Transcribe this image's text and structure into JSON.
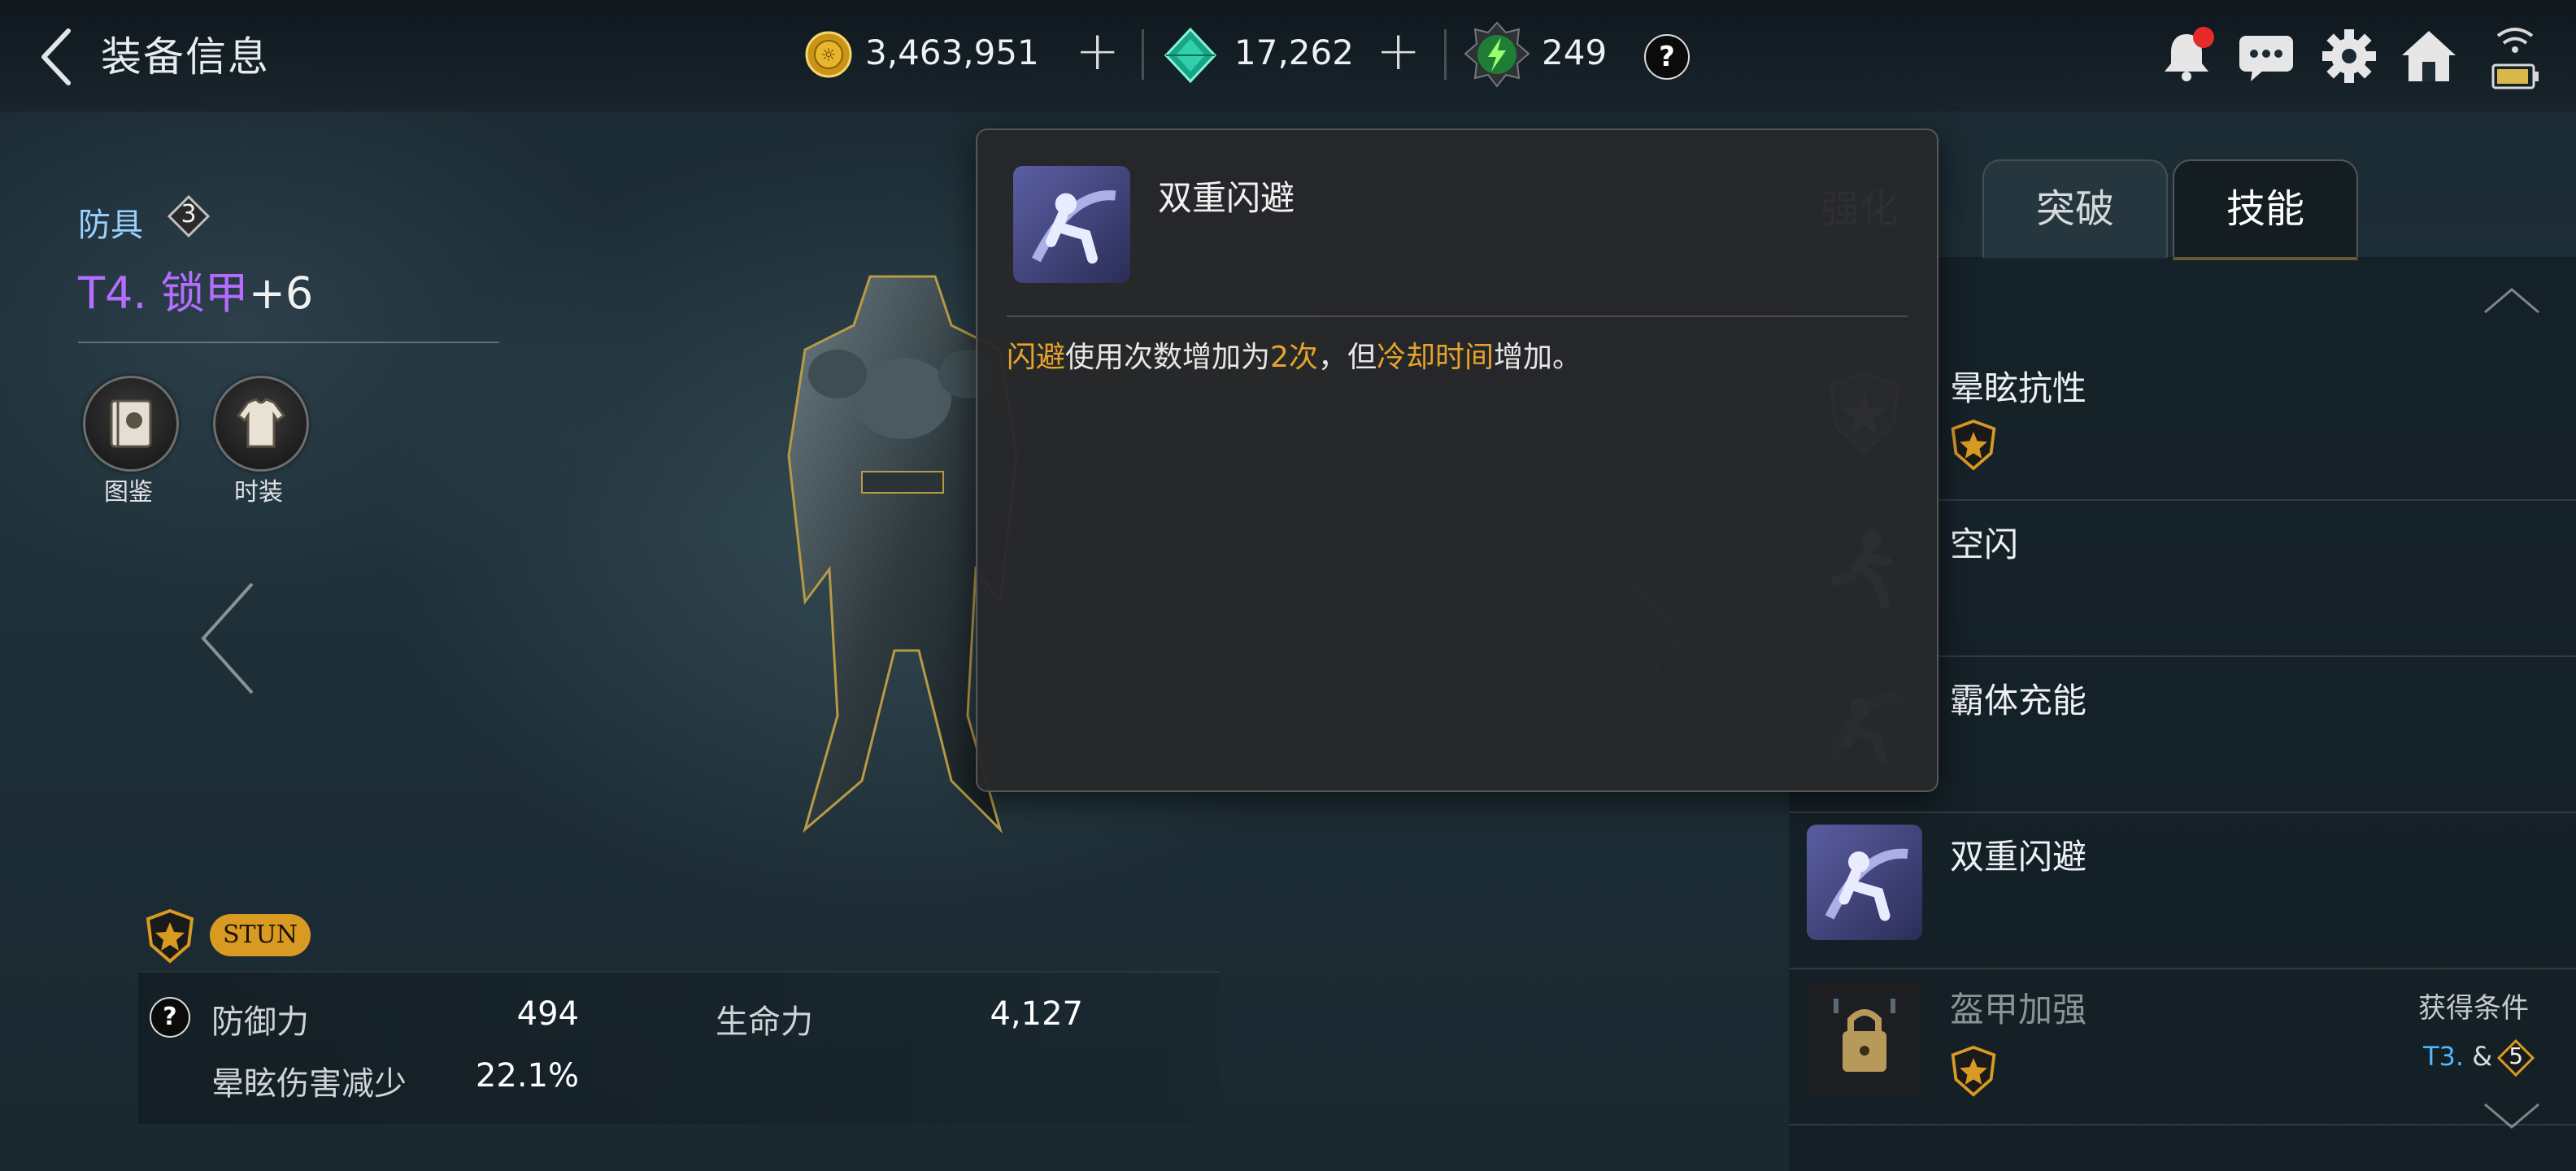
{
  "header": {
    "title": "装备信息",
    "gold": "3,463,951",
    "gems": "17,262",
    "energy": "249",
    "help": "?"
  },
  "item": {
    "category": "防具",
    "category_level": "3",
    "tier": "T4.",
    "name": "锁甲",
    "enhance": "+6",
    "buttons": [
      {
        "label": "图鉴",
        "icon": "book-icon"
      },
      {
        "label": "时装",
        "icon": "costume-icon"
      }
    ]
  },
  "stats": {
    "tag": "STUN",
    "help": "?",
    "rows": [
      {
        "label": "防御力",
        "value": "494"
      },
      {
        "label": "生命力",
        "value": "4,127"
      },
      {
        "label": "晕眩伤害减少",
        "value": "22.1%"
      }
    ]
  },
  "tabs": [
    {
      "label": "强化",
      "active": false
    },
    {
      "label": "突破",
      "active": false
    },
    {
      "label": "技能",
      "active": true
    }
  ],
  "skills": [
    {
      "name": "晕眩抗性",
      "icon": "shield-star-icon",
      "badge": true
    },
    {
      "name": "空闪",
      "icon": "dodge-run-icon",
      "badge": false
    },
    {
      "name": "霸体充能",
      "icon": "charge-dash-icon",
      "badge": false
    },
    {
      "name": "双重闪避",
      "icon": "double-dodge-icon",
      "badge": false
    },
    {
      "name": "盔甲加强",
      "icon": "armor-lock-icon",
      "badge": true,
      "requirement_label": "获得条件",
      "requirement_tier": "T3.",
      "requirement_amp": "&",
      "requirement_level": "5"
    }
  ],
  "tooltip": {
    "title": "双重闪避",
    "desc_parts": [
      {
        "text": "闪避",
        "highlight": true
      },
      {
        "text": "使用次数增加为",
        "highlight": false
      },
      {
        "text": "2次",
        "highlight": true
      },
      {
        "text": "，但",
        "highlight": false
      },
      {
        "text": "冷却时间",
        "highlight": true
      },
      {
        "text": "增加。",
        "highlight": false
      }
    ]
  },
  "colors": {
    "accent_gold": "#e7a42a",
    "tier_purple": "#b56dff",
    "category_blue": "#9ad0ff",
    "notify_red": "#e52a2a"
  }
}
